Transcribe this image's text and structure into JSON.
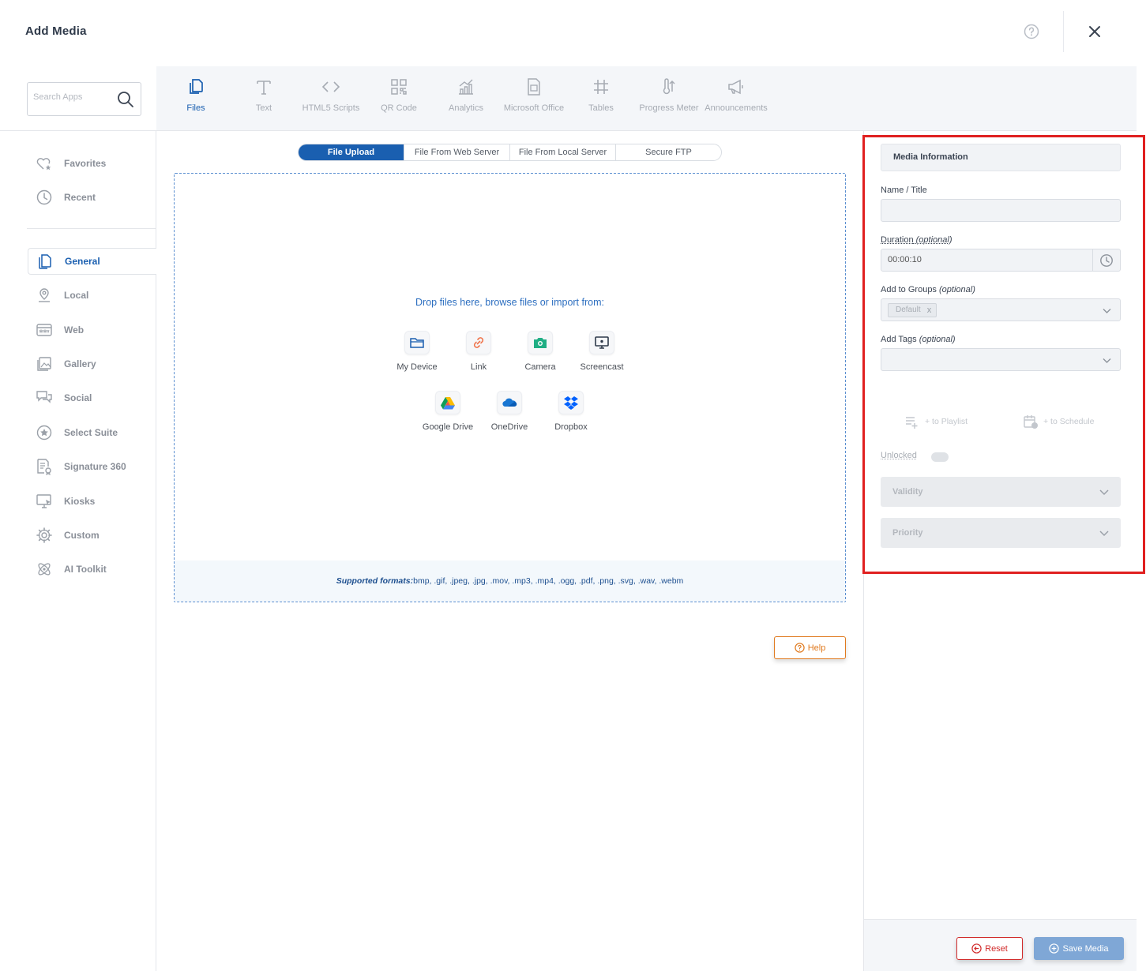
{
  "header": {
    "title": "Add Media"
  },
  "search": {
    "placeholder": "Search Apps"
  },
  "sidebar": {
    "items": [
      {
        "label": "Favorites",
        "icon": "heart-star-icon"
      },
      {
        "label": "Recent",
        "icon": "clock-icon"
      },
      {
        "label": "General",
        "icon": "files-icon",
        "active": true
      },
      {
        "label": "Local",
        "icon": "map-pin-icon"
      },
      {
        "label": "Web",
        "icon": "www-icon"
      },
      {
        "label": "Gallery",
        "icon": "gallery-icon"
      },
      {
        "label": "Social",
        "icon": "chat-bubbles-icon"
      },
      {
        "label": "Select Suite",
        "icon": "star-circle-icon"
      },
      {
        "label": "Signature 360",
        "icon": "document-badge-icon"
      },
      {
        "label": "Kiosks",
        "icon": "monitor-touch-icon"
      },
      {
        "label": "Custom",
        "icon": "gear-icon"
      },
      {
        "label": "AI Toolkit",
        "icon": "atom-icon"
      }
    ]
  },
  "apps": [
    {
      "label": "Files",
      "icon": "files-icon",
      "active": true
    },
    {
      "label": "Text",
      "icon": "text-icon"
    },
    {
      "label": "HTML5 Scripts",
      "icon": "code-icon"
    },
    {
      "label": "QR Code",
      "icon": "qr-code-icon"
    },
    {
      "label": "Analytics",
      "icon": "analytics-icon"
    },
    {
      "label": "Microsoft Office",
      "icon": "office-doc-icon"
    },
    {
      "label": "Tables",
      "icon": "grid-icon"
    },
    {
      "label": "Progress Meter",
      "icon": "thermometer-icon"
    },
    {
      "label": "Announcements",
      "icon": "megaphone-icon"
    }
  ],
  "upload_tabs": [
    {
      "label": "File Upload",
      "active": true
    },
    {
      "label": "File From Web Server"
    },
    {
      "label": "File From Local Server"
    },
    {
      "label": "Secure FTP"
    }
  ],
  "dropzone": {
    "prompt": "Drop files here, browse files or import from:",
    "sources": [
      {
        "label": "My Device",
        "icon": "folder-icon"
      },
      {
        "label": "Link",
        "icon": "link-icon"
      },
      {
        "label": "Camera",
        "icon": "camera-icon"
      },
      {
        "label": "Screencast",
        "icon": "screencast-icon"
      },
      {
        "label": "Google Drive",
        "icon": "google-drive-icon"
      },
      {
        "label": "OneDrive",
        "icon": "onedrive-icon"
      },
      {
        "label": "Dropbox",
        "icon": "dropbox-icon"
      }
    ],
    "formats_label": "Supported formats:",
    "formats_list": "bmp, .gif, .jpeg, .jpg, .mov, .mp3, .mp4, .ogg, .pdf, .png, .svg, .wav, .webm"
  },
  "help_button": "Help",
  "media_info": {
    "heading": "Media Information",
    "name_label": "Name / Title",
    "name_value": "",
    "duration_label": "Duration",
    "duration_optional": "(optional)",
    "duration_value": "00:00:10",
    "groups_label": "Add to Groups",
    "groups_optional": "(optional)",
    "groups_chip": "Default",
    "groups_chip_remove": "x",
    "tags_label": "Add Tags",
    "tags_optional": "(optional)",
    "to_playlist": "+ to Playlist",
    "to_schedule": "+ to Schedule",
    "lock_label": "Unlocked",
    "validity_label": "Validity",
    "priority_label": "Priority"
  },
  "footer": {
    "reset_label": "Reset",
    "save_label": "Save Media"
  },
  "colors": {
    "accent": "#1a5fb0",
    "help_orange": "#e07a1f",
    "reset_red": "#d12b2b",
    "highlight_red": "#e02020",
    "save_disabled": "#7fa7d6"
  }
}
